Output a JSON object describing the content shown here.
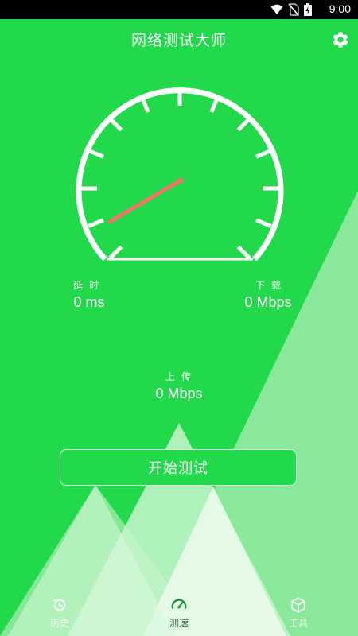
{
  "status_bar": {
    "time": "9:00"
  },
  "header": {
    "title": "网络测试大师"
  },
  "stats": {
    "latency": {
      "label": "延时",
      "value": "0 ms"
    },
    "download": {
      "label": "下载",
      "value": "0 Mbps"
    },
    "upload": {
      "label": "上传",
      "value": "0 Mbps"
    }
  },
  "start_button": {
    "label": "开始测试"
  },
  "bottom_nav": {
    "items": [
      {
        "label": "历史",
        "icon": "history-icon"
      },
      {
        "label": "测速",
        "icon": "speedometer-icon"
      },
      {
        "label": "工具",
        "icon": "cube-icon"
      }
    ]
  },
  "colors": {
    "background": "#21d94a",
    "needle": "#f2756a",
    "mountain_light": "#e8fbe9",
    "mountain_mid": "#8fe99e"
  }
}
